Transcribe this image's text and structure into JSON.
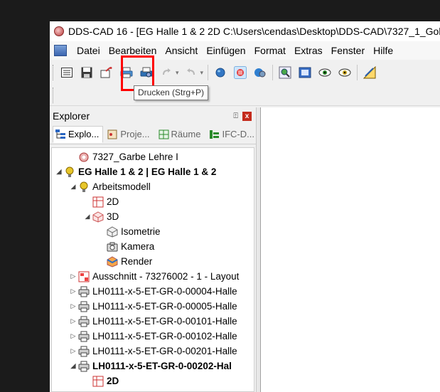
{
  "window": {
    "title": "DDS-CAD 16 - [EG Halle 1 & 2  2D  C:\\Users\\cendas\\Desktop\\DDS-CAD\\7327_1_Gol"
  },
  "menu": [
    "Datei",
    "Bearbeiten",
    "Ansicht",
    "Einfügen",
    "Format",
    "Extras",
    "Fenster",
    "Hilfe"
  ],
  "tooltip": "Drucken (Strg+P)",
  "toolbar_icons": [
    "list-icon",
    "save-icon",
    "undo-icon",
    "print-icon",
    "print-preview-icon",
    "redo-icon",
    "repeat-icon",
    "globe-icon",
    "selection-icon",
    "layers-icon",
    "zoom-icon",
    "window-icon",
    "eye-icon",
    "eye-settings-icon",
    "measure-icon"
  ],
  "explorer": {
    "title": "Explorer",
    "pin": "⍐",
    "close": "x",
    "tabs": [
      "Explo...",
      "Proje...",
      "Räume",
      "IFC-D..."
    ]
  },
  "tree": [
    {
      "label": "7327_Garbe Lehre I",
      "level": 1,
      "icon": "project-icon",
      "expander": "",
      "bold": false
    },
    {
      "label": "EG Halle 1 & 2 | EG Halle 1 & 2",
      "level": 0,
      "icon": "bulb-icon",
      "expander": "◢",
      "bold": true
    },
    {
      "label": "Arbeitsmodell",
      "level": 1,
      "icon": "bulb-icon",
      "expander": "◢",
      "bold": false
    },
    {
      "label": "2D",
      "level": 2,
      "icon": "sheet-2d-icon",
      "expander": "",
      "bold": false
    },
    {
      "label": "3D",
      "level": 2,
      "icon": "cube-3d-icon",
      "expander": "◢",
      "bold": false
    },
    {
      "label": "Isometrie",
      "level": 3,
      "icon": "isometry-icon",
      "expander": "",
      "bold": false
    },
    {
      "label": "Kamera",
      "level": 3,
      "icon": "camera-icon",
      "expander": "",
      "bold": false
    },
    {
      "label": "Render",
      "level": 3,
      "icon": "render-icon",
      "expander": "",
      "bold": false
    },
    {
      "label": "Ausschnitt - 73276002 - 1 - Layout",
      "level": 1,
      "icon": "layout-icon",
      "expander": "▷",
      "bold": false
    },
    {
      "label": "LH0111-x-5-ET-GR-0-00004-Halle",
      "level": 1,
      "icon": "printer-icon",
      "expander": "▷",
      "bold": false
    },
    {
      "label": "LH0111-x-5-ET-GR-0-00005-Halle",
      "level": 1,
      "icon": "printer-icon",
      "expander": "▷",
      "bold": false
    },
    {
      "label": "LH0111-x-5-ET-GR-0-00101-Halle",
      "level": 1,
      "icon": "printer-icon",
      "expander": "▷",
      "bold": false
    },
    {
      "label": "LH0111-x-5-ET-GR-0-00102-Halle",
      "level": 1,
      "icon": "printer-icon",
      "expander": "▷",
      "bold": false
    },
    {
      "label": "LH0111-x-5-ET-GR-0-00201-Halle",
      "level": 1,
      "icon": "printer-icon",
      "expander": "▷",
      "bold": false
    },
    {
      "label": "LH0111-x-5-ET-GR-0-00202-Hal",
      "level": 1,
      "icon": "printer-icon",
      "expander": "◢",
      "bold": true
    },
    {
      "label": "2D",
      "level": 2,
      "icon": "sheet-2d-icon",
      "expander": "",
      "bold": true
    }
  ]
}
